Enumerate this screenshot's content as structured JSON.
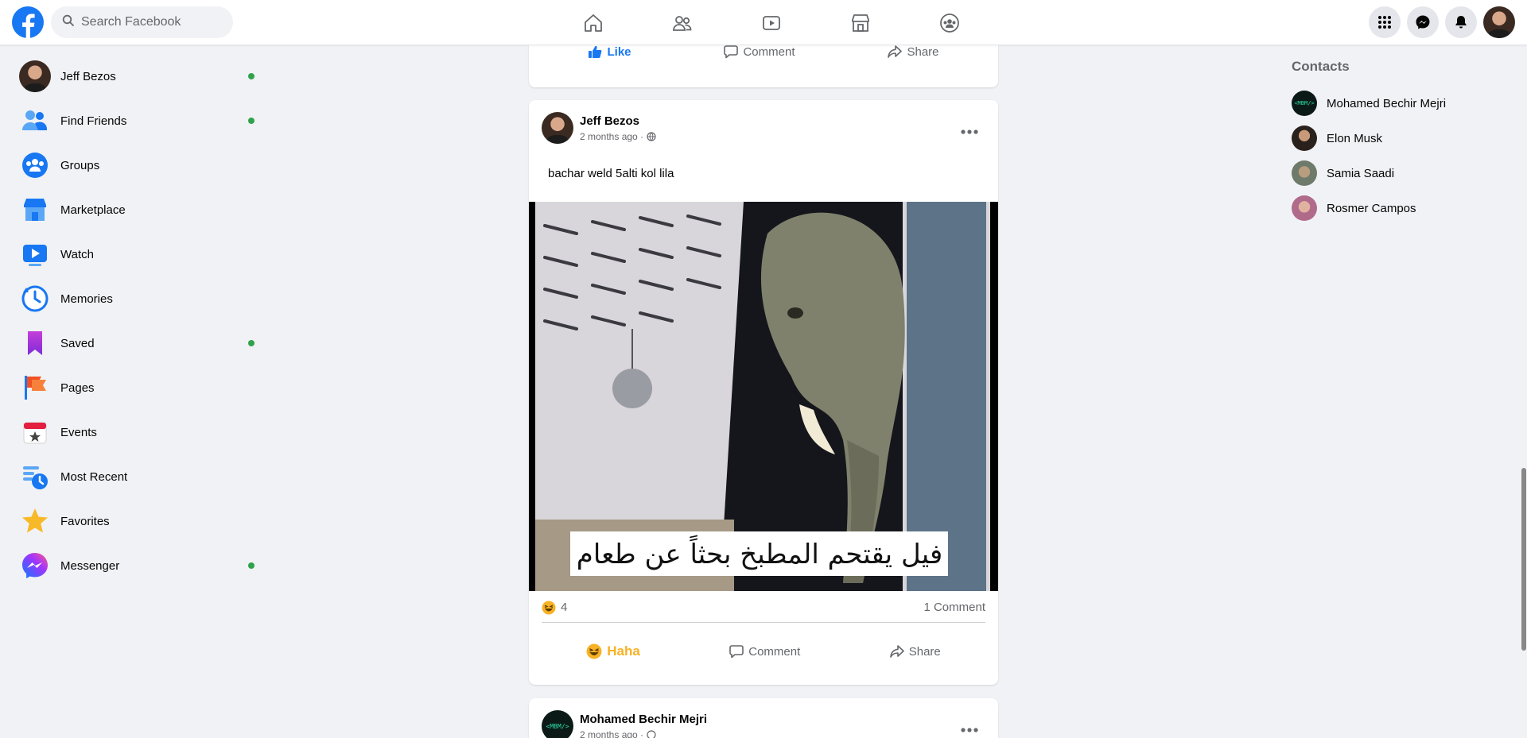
{
  "topbar": {
    "search_placeholder": "Search Facebook",
    "nav": [
      "home-icon",
      "friends-icon",
      "watch-icon",
      "marketplace-icon",
      "groups-icon"
    ],
    "right": [
      "menu-grid-icon",
      "messenger-icon",
      "notifications-icon",
      "profile-avatar"
    ]
  },
  "sidebar": {
    "items": [
      {
        "label": "Jeff Bezos",
        "icon": "profile-avatar",
        "online": true
      },
      {
        "label": "Find Friends",
        "icon": "friends-icon",
        "online": true
      },
      {
        "label": "Groups",
        "icon": "groups-icon",
        "online": false
      },
      {
        "label": "Marketplace",
        "icon": "marketplace-icon",
        "online": false
      },
      {
        "label": "Watch",
        "icon": "watch-icon",
        "online": false
      },
      {
        "label": "Memories",
        "icon": "memories-icon",
        "online": false
      },
      {
        "label": "Saved",
        "icon": "saved-icon",
        "online": true
      },
      {
        "label": "Pages",
        "icon": "pages-icon",
        "online": false
      },
      {
        "label": "Events",
        "icon": "events-icon",
        "online": false
      },
      {
        "label": "Most Recent",
        "icon": "most-recent-icon",
        "online": false
      },
      {
        "label": "Favorites",
        "icon": "favorites-icon",
        "online": false
      },
      {
        "label": "Messenger",
        "icon": "messenger-icon",
        "online": true
      }
    ]
  },
  "top_post_actions": {
    "like": "Like",
    "comment": "Comment",
    "share": "Share"
  },
  "post": {
    "author": "Jeff Bezos",
    "time": "2 months ago ·",
    "text": "bachar weld 5alti kol lila",
    "image_caption": "فيل يقتحم المطبخ بحثاً عن طعام",
    "reaction_count": "4",
    "comments": "1 Comment",
    "actions": {
      "haha": "Haha",
      "comment": "Comment",
      "share": "Share"
    }
  },
  "next_post": {
    "author": "Mohamed Bechir Mejri",
    "time": "2 months ago ·",
    "avatar_text": "<MBM/>"
  },
  "contacts": {
    "title": "Contacts",
    "items": [
      "Mohamed Bechir Mejri",
      "Elon Musk",
      "Samia Saadi",
      "Rosmer Campos"
    ]
  },
  "colors": {
    "brand": "#1877f2",
    "online": "#31a24c",
    "haha": "#f7b125",
    "background": "#f0f2f5"
  }
}
